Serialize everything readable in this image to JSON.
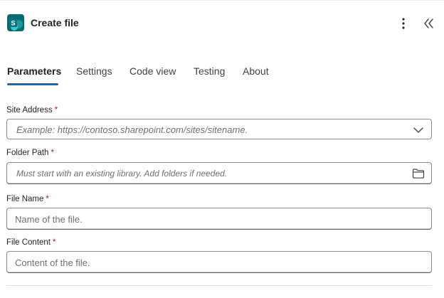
{
  "header": {
    "app_icon": "sharepoint-icon",
    "app_icon_letter": "S",
    "title": "Create file",
    "more_icon": "more-vertical-icon",
    "collapse_icon": "double-chevron-left-icon"
  },
  "tabs": [
    {
      "label": "Parameters",
      "active": true
    },
    {
      "label": "Settings",
      "active": false
    },
    {
      "label": "Code view",
      "active": false
    },
    {
      "label": "Testing",
      "active": false
    },
    {
      "label": "About",
      "active": false
    }
  ],
  "form": {
    "required_marker": "*",
    "site_address": {
      "label": "Site Address",
      "placeholder": "Example: https://contoso.sharepoint.com/sites/sitename.",
      "icon": "chevron-down-icon"
    },
    "folder_path": {
      "label": "Folder Path",
      "placeholder": "Must start with an existing library. Add folders if needed.",
      "icon": "folder-icon"
    },
    "file_name": {
      "label": "File Name",
      "placeholder": "Name of the file."
    },
    "file_content": {
      "label": "File Content",
      "placeholder": "Content of the file."
    }
  },
  "colors": {
    "accent": "#0f6cbd",
    "required": "#c50f1f",
    "app_icon_bg": "#036c70"
  }
}
